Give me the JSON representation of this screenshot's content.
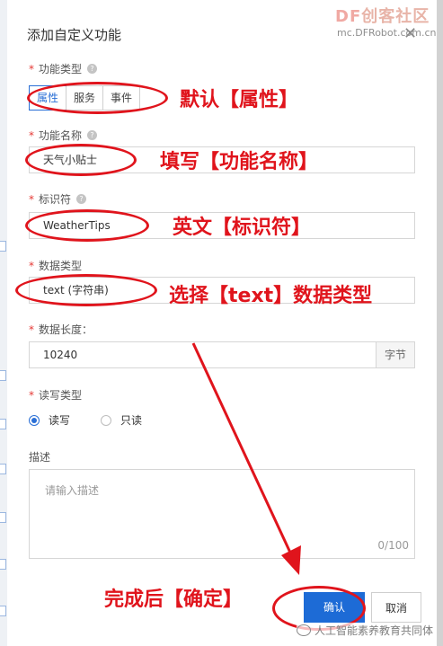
{
  "dialog": {
    "title": "添加自定义功能",
    "close_icon": "close-icon",
    "function_type": {
      "label": "功能类型",
      "options": [
        "属性",
        "服务",
        "事件"
      ],
      "selected": "属性"
    },
    "function_name": {
      "label": "功能名称",
      "value": "天气小贴士"
    },
    "identifier": {
      "label": "标识符",
      "value": "WeatherTips"
    },
    "data_type": {
      "label": "数据类型",
      "value": "text (字符串)"
    },
    "data_length": {
      "label": "数据长度：",
      "value": "10240",
      "unit": "字节"
    },
    "rw_type": {
      "label": "读写类型",
      "options": [
        "读写",
        "只读"
      ],
      "selected": "读写"
    },
    "description": {
      "label": "描述",
      "placeholder": "请输入描述",
      "counter": "0/100"
    },
    "buttons": {
      "confirm": "确认",
      "cancel": "取消"
    }
  },
  "annotations": {
    "default_property": "默认【属性】",
    "fill_name": "填写【功能名称】",
    "english_identifier": "英文【标识符】",
    "select_text": "选择【text】数据类型",
    "confirm_after": "完成后【确定】",
    "color": "#e0141c"
  },
  "watermarks": {
    "logo_df": "DF",
    "logo_cn": "创客社区",
    "url": "mc.DFRobot.com.cn",
    "footer": "人工智能素养教育共同体"
  }
}
